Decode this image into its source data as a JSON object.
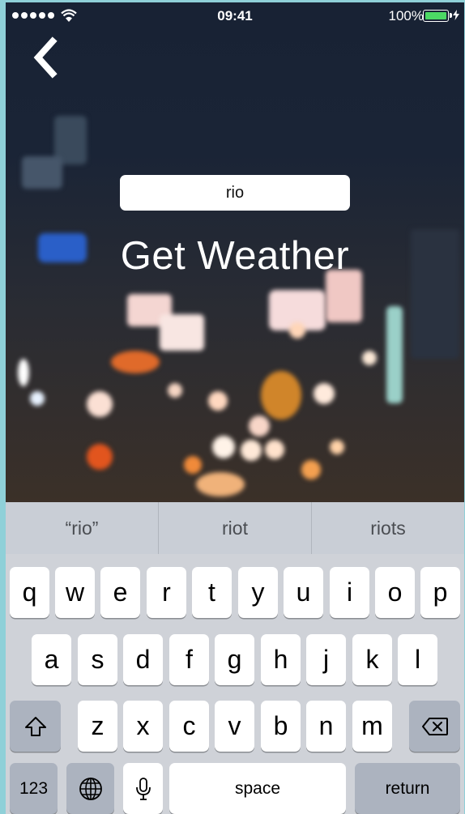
{
  "status_bar": {
    "time": "09:41",
    "battery_percent": "100%"
  },
  "search": {
    "value": "rio"
  },
  "title": "Get Weather",
  "predictions": [
    "“rio”",
    "riot",
    "riots"
  ],
  "keyboard": {
    "row1": [
      "q",
      "w",
      "e",
      "r",
      "t",
      "y",
      "u",
      "i",
      "o",
      "p"
    ],
    "row2": [
      "a",
      "s",
      "d",
      "f",
      "g",
      "h",
      "j",
      "k",
      "l"
    ],
    "row3": [
      "z",
      "x",
      "c",
      "v",
      "b",
      "n",
      "m"
    ],
    "numbers_label": "123",
    "space_label": "space",
    "return_label": "return"
  },
  "colors": {
    "battery": "#4cd964",
    "keyboard_bg": "#cfd2d8",
    "predictive_bg": "#c9ced6"
  },
  "icons": [
    "back-chevron-icon",
    "wifi-icon",
    "battery-icon",
    "shift-icon",
    "delete-icon",
    "globe-icon",
    "microphone-icon"
  ]
}
